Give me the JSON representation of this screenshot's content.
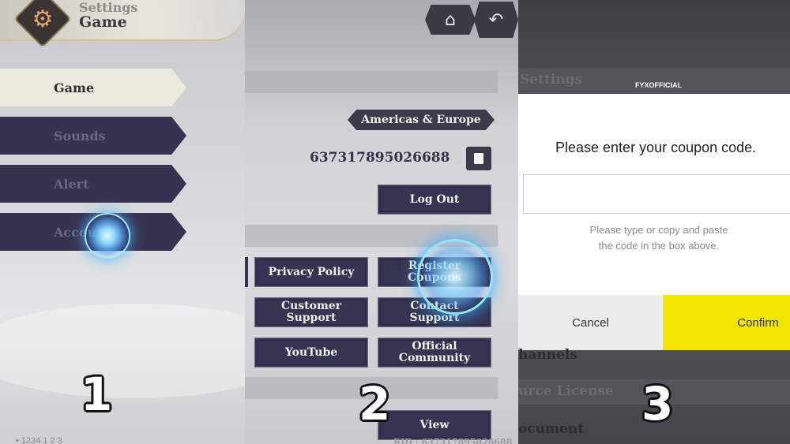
{
  "panel1": {
    "header": {
      "small_title": "Settings",
      "big_title": "Game"
    },
    "menu": [
      {
        "label": "Game",
        "active": true
      },
      {
        "label": "Sounds",
        "active": false
      },
      {
        "label": "Alert",
        "active": false
      },
      {
        "label": "Account",
        "active": false
      }
    ],
    "step": "1",
    "bottom_text": "• 1234 1 2 3"
  },
  "panel2": {
    "home_icon": "home-icon",
    "back_icon": "back-arrow-icon",
    "region": "Americas & Europe",
    "uid": "637317895026688",
    "logout_label": "Log Out",
    "buttons": {
      "privacy_policy": "Privacy Policy",
      "register_coupons": "Register Coupons",
      "customer_support": "Customer Support",
      "contact_support": "Contact Support",
      "youtube": "YouTube",
      "official_community": "Official Community",
      "view": "View"
    },
    "rid": "RID : 637317895026688",
    "step": "2"
  },
  "panel3": {
    "bg_settings": "Settings",
    "bg_channels": "hannels",
    "bg_license": "urce License",
    "bg_document": "ocument",
    "watermark": "FYXOFFICIAL",
    "dialog": {
      "prompt": "Please enter your coupon code.",
      "input_value": "",
      "hint_line1": "Please type or copy and paste",
      "hint_line2": "the code in the box above.",
      "cancel_label": "Cancel",
      "confirm_label": "Confirm"
    },
    "step": "3"
  },
  "colors": {
    "menu_dark": "#37324f",
    "menu_active": "#ece9df",
    "button_navy": "#353452",
    "confirm_yellow": "#f2e600",
    "glow_blue": "#49b3ff"
  }
}
